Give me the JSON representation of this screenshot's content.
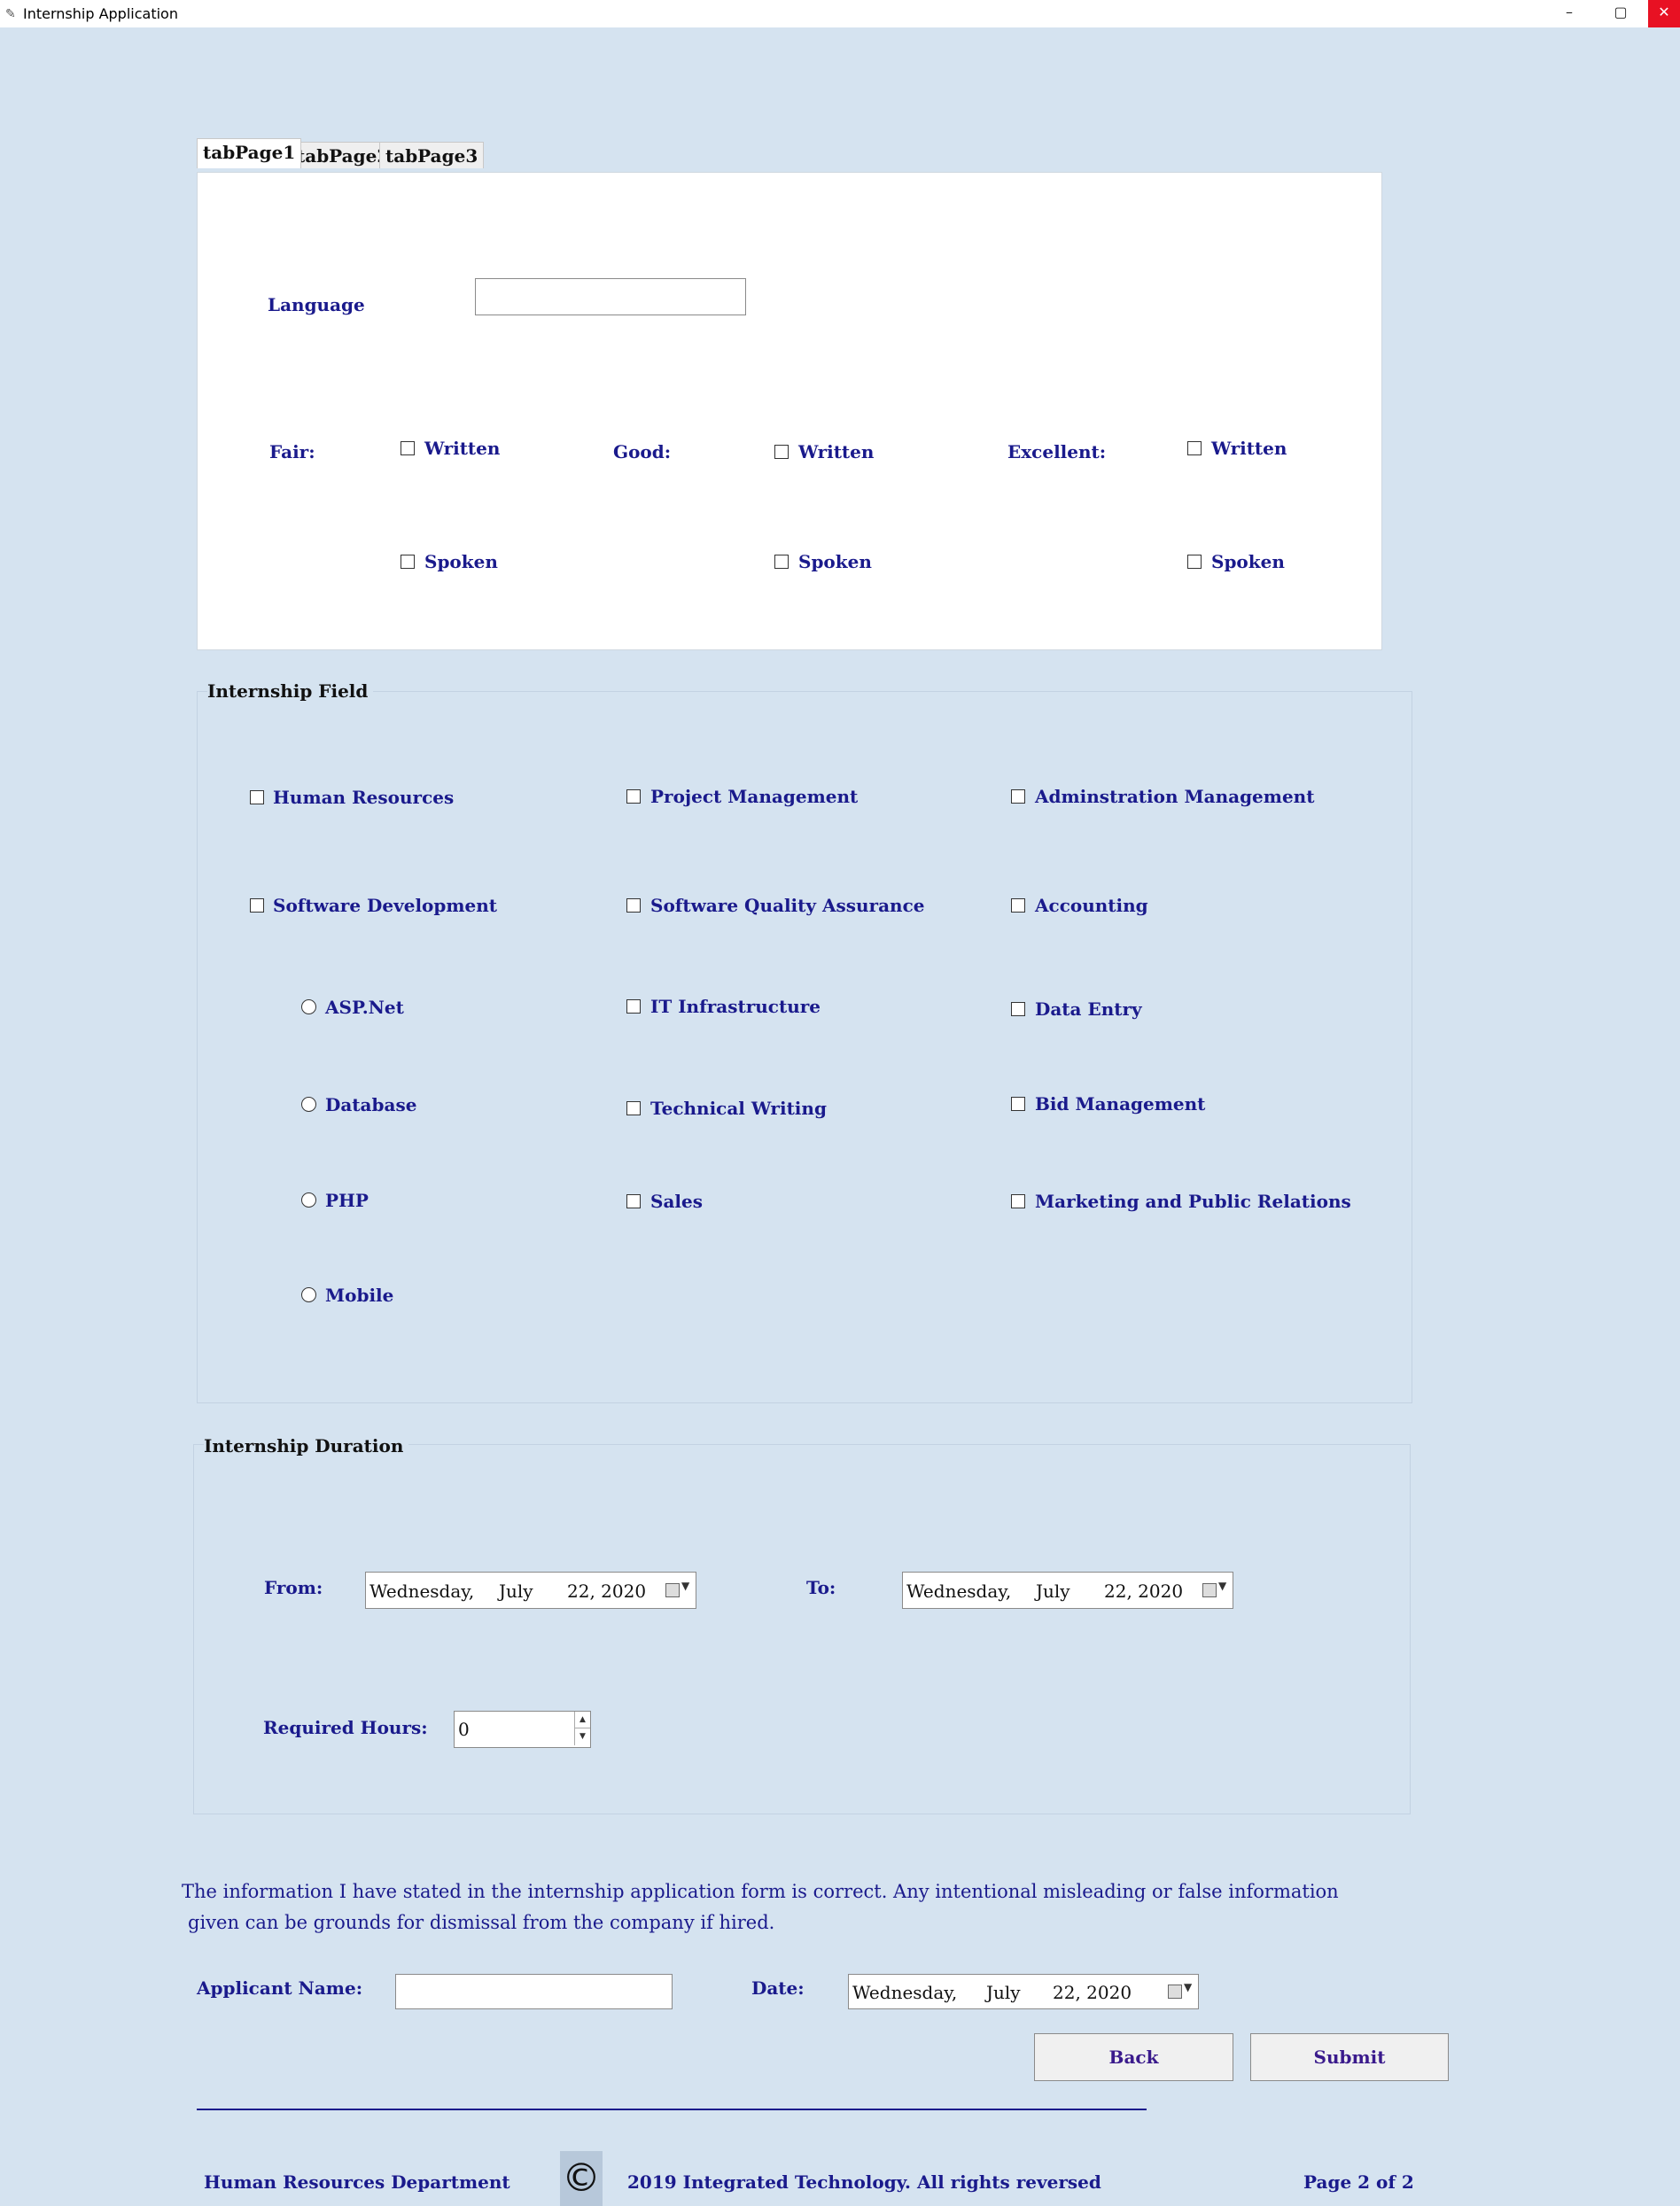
{
  "window": {
    "title": "Internship Application",
    "minimize": "–",
    "maximize": "▢",
    "close": "✕"
  },
  "tabs": [
    "tabPage1",
    "tabPage2",
    "tabPage3"
  ],
  "language": {
    "label": "Language",
    "value": "",
    "levels": [
      {
        "label": "Fair:",
        "written": "Written",
        "spoken": "Spoken"
      },
      {
        "label": "Good:",
        "written": "Written",
        "spoken": "Spoken"
      },
      {
        "label": "Excellent:",
        "written": "Written",
        "spoken": "Spoken"
      }
    ]
  },
  "internship_field": {
    "title": "Internship Field",
    "col1": [
      "Human Resources",
      "Software Development"
    ],
    "radios": [
      "ASP.Net",
      "Database",
      "PHP",
      "Mobile"
    ],
    "col2": [
      "Project Management",
      "Software Quality Assurance",
      "IT Infrastructure",
      "Technical Writing",
      "Sales"
    ],
    "col3": [
      "Adminstration Management",
      "Accounting",
      "Data Entry",
      "Bid Management",
      "Marketing and Public Relations"
    ]
  },
  "duration": {
    "title": "Internship Duration",
    "from_label": "From:",
    "to_label": "To:",
    "from": {
      "day": "Wednesday,",
      "month": "July",
      "date": "22, 2020"
    },
    "to": {
      "day": "Wednesday,",
      "month": "July",
      "date": "22, 2020"
    },
    "hours_label": "Required Hours:",
    "hours_value": "0"
  },
  "declaration": {
    "line1": "The information I have stated in the internship application form is correct. Any intentional misleading or false information",
    "line2": "given can be grounds for dismissal from the company if hired.",
    "applicant_label": "Applicant Name:",
    "applicant_value": "",
    "date_label": "Date:",
    "date": {
      "day": "Wednesday,",
      "month": "July",
      "date": "22, 2020"
    }
  },
  "buttons": {
    "back": "Back",
    "submit": "Submit"
  },
  "footer": {
    "department": "Human Resources Department",
    "copyright_symbol": "©",
    "copyright_text": "2019 Integrated Technology. All rights reversed",
    "page": "Page 2 of 2"
  }
}
